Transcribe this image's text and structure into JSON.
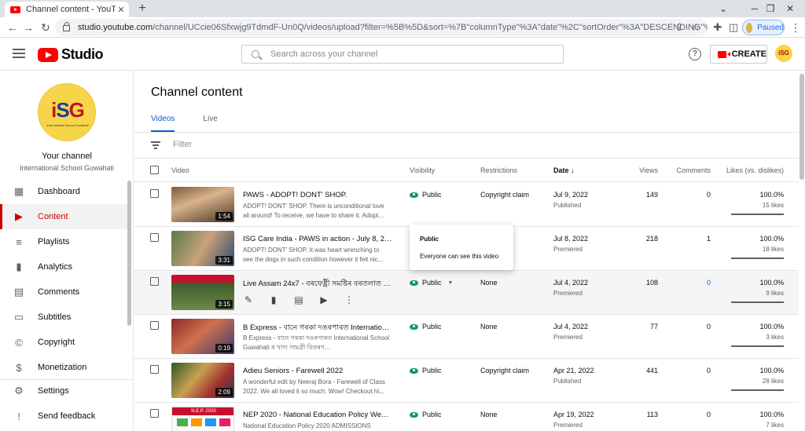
{
  "browser": {
    "tab_title": "Channel content - YouTube Studio",
    "url_host": "studio.youtube.com",
    "url_path": "/channel/UCcie06Sfxwjg9TdmdF-Un0Q/videos/upload?filter=%5B%5D&sort=%7B\"columnType\"%3A\"date\"%2C\"sortOrder\"%3A\"DESCENDING\"%7D",
    "profile_status": "Paused"
  },
  "header": {
    "logo_text": "Studio",
    "search_placeholder": "Search across your channel",
    "create_label": "CREATE",
    "help_glyph": "?",
    "avatar_text": "iSG",
    "accent_color": "#ff0000"
  },
  "sidebar": {
    "avatar_logo": "iSG",
    "avatar_tagline": "International School Guwahati",
    "your_channel_label": "Your channel",
    "channel_name": "International School Guwahati",
    "items": [
      {
        "label": "Dashboard",
        "icon": "dashboard-icon",
        "active": false
      },
      {
        "label": "Content",
        "icon": "content-icon",
        "active": true
      },
      {
        "label": "Playlists",
        "icon": "playlists-icon",
        "active": false
      },
      {
        "label": "Analytics",
        "icon": "analytics-icon",
        "active": false
      },
      {
        "label": "Comments",
        "icon": "comments-icon",
        "active": false
      },
      {
        "label": "Subtitles",
        "icon": "subtitles-icon",
        "active": false
      },
      {
        "label": "Copyright",
        "icon": "copyright-icon",
        "active": false
      },
      {
        "label": "Monetization",
        "icon": "monetization-icon",
        "active": false
      }
    ],
    "bottom_items": [
      {
        "label": "Settings",
        "icon": "gear-icon"
      },
      {
        "label": "Send feedback",
        "icon": "feedback-icon"
      }
    ]
  },
  "main": {
    "title": "Channel content",
    "tabs": [
      {
        "label": "Videos",
        "active": true
      },
      {
        "label": "Live",
        "active": false
      }
    ],
    "filter_placeholder": "Filter",
    "columns": {
      "video": "Video",
      "visibility": "Visibility",
      "restrictions": "Restrictions",
      "date": "Date",
      "views": "Views",
      "comments": "Comments",
      "likes": "Likes (vs. dislikes)"
    },
    "sort_arrow": "↓",
    "rows": [
      {
        "title": "PAWS - ADOPT! DONT' SHOP.",
        "description": "ADOPT! DONT' SHOP. There is unconditional love all around! To receive, we have to share it. Adopt...",
        "duration": "1:54",
        "visibility": "Public",
        "restriction": "Copyright claim",
        "date": "Jul 9, 2022",
        "date_status": "Published",
        "views": "149",
        "comments": "0",
        "likes_pct": "100.0%",
        "likes_count": "15 likes"
      },
      {
        "title": "ISG Care India - PAWS in action - July 8, 2022",
        "description": "ADOPT! DONT' SHOP. It was heart wrenching to see the dogs in such condition however it felt nic...",
        "duration": "3:31",
        "visibility": "Public",
        "restriction": "",
        "date": "Jul 8, 2022",
        "date_status": "Premiered",
        "views": "218",
        "comments": "1",
        "likes_pct": "100.0%",
        "likes_count": "18 likes"
      },
      {
        "title": "Live Assam 24x7 - বৰফেষ্ট্ৰী সমষ্টিৰ বৰতলাত বা...",
        "description": "",
        "duration": "3:15",
        "visibility": "Public",
        "restriction": "None",
        "date": "Jul 4, 2022",
        "date_status": "Premiered",
        "views": "108",
        "comments": "0",
        "likes_pct": "100.0%",
        "likes_count": "9 likes"
      },
      {
        "title": "B Express - বানে গৰকা দঙৰপাৰত International...",
        "description": "B Express - বানে গৰকা দঙৰপাৰত International School Guwahati ৰ খাদ্য সামগ্ৰী বিতৰণ...",
        "duration": "0:19",
        "visibility": "Public",
        "restriction": "None",
        "date": "Jul 4, 2022",
        "date_status": "Premiered",
        "views": "77",
        "comments": "0",
        "likes_pct": "100.0%",
        "likes_count": "3 likes"
      },
      {
        "title": "Adieu Seniors - Farewell 2022",
        "description": "A wonderful edit by Neeraj Bora - Farewell of Class 2022. We all loved it so much. Wow! Checkout hi...",
        "duration": "2:09",
        "visibility": "Public",
        "restriction": "Copyright claim",
        "date": "Apr 21, 2022",
        "date_status": "Published",
        "views": "441",
        "comments": "0",
        "likes_pct": "100.0%",
        "likes_count": "28 likes"
      },
      {
        "title": "NEP 2020 - National Education Policy Webinar",
        "description": "National Education Policy 2020 ADMISSIONS",
        "duration": "",
        "thumb_caption": "N.E.P. 2020",
        "visibility": "Public",
        "restriction": "None",
        "date": "Apr 19, 2022",
        "date_status": "Premiered",
        "views": "113",
        "comments": "0",
        "likes_pct": "100.0%",
        "likes_count": "7 likes"
      }
    ],
    "tooltip": {
      "title": "Public",
      "description": "Everyone can see this video"
    }
  }
}
